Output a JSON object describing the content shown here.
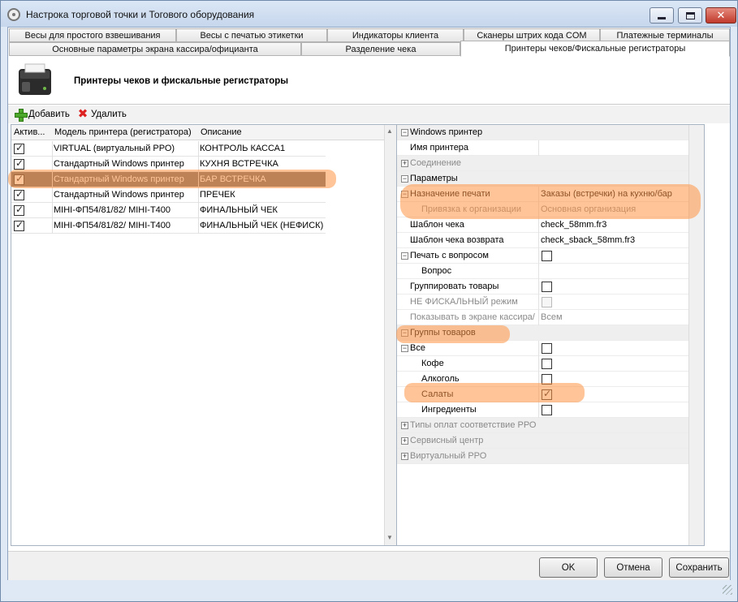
{
  "window": {
    "title": "Настрока торговой точки и Тогового оборудования"
  },
  "tabs_row1": [
    "Весы для простого взвешивания",
    "Весы с печатью этикетки",
    "Индикаторы клиента",
    "Сканеры штрих кода COM",
    "Платежные терминалы"
  ],
  "tabs_row2": [
    "Основные параметры экрана кассира/официанта",
    "Разделение чека",
    "Принтеры чеков/Фискальные регистраторы"
  ],
  "header": {
    "title": "Принтеры чеков и фискальные регистраторы"
  },
  "toolbar": {
    "add_label": "Добавить",
    "delete_label": "Удалить"
  },
  "printers": {
    "columns": [
      "Актив...",
      "Модель принтера (регистратора)",
      "Описание"
    ],
    "rows": [
      {
        "active": true,
        "model": "VIRTUAL (виртуальный РРО)",
        "description": "КОНТРОЛЬ КАССА1"
      },
      {
        "active": true,
        "model": "Стандартный Windows принтер",
        "description": "КУХНЯ ВСТРЕЧКА"
      },
      {
        "active": true,
        "model": "Стандартный Windows принтер",
        "description": "БАР ВСТРЕЧКА",
        "selected": true
      },
      {
        "active": true,
        "model": "Стандартный Windows принтер",
        "description": "ПРЕЧЕК"
      },
      {
        "active": true,
        "model": "МІНІ-ФП54/81/82/  МІНІ-Т400",
        "description": "ФИНАЛЬНЫЙ ЧЕК"
      },
      {
        "active": true,
        "model": "МІНІ-ФП54/81/82/  МІНІ-Т400",
        "description": "ФИНАЛЬНЫЙ ЧЕК (НЕФИСК)"
      }
    ]
  },
  "properties": {
    "rows": [
      {
        "name": "Windows принтер",
        "type": "category",
        "expander": "−"
      },
      {
        "name": "Имя принтера",
        "value": ""
      },
      {
        "name": "Соединение",
        "type": "category",
        "expander": "+",
        "muted": true
      },
      {
        "name": "Параметры",
        "type": "category",
        "expander": "−"
      },
      {
        "name": "Назначение печати",
        "value": "Заказы (встречки) на кухню/бар",
        "expander": "−"
      },
      {
        "name": "Привязка к организации",
        "value": "Основная организация",
        "muted": true,
        "indent": true
      },
      {
        "name": "Шаблон чека",
        "value": "check_58mm.fr3"
      },
      {
        "name": "Шаблон чека возврата",
        "value": "check_sback_58mm.fr3"
      },
      {
        "name": "Печать с вопросом",
        "checkbox": false,
        "expander": "−"
      },
      {
        "name": "Вопрос",
        "value": "",
        "indent": true
      },
      {
        "name": "Группировать товары",
        "checkbox": false
      },
      {
        "name": "НЕ ФИСКАЛЬНЫЙ режим",
        "checkbox": false,
        "muted": true,
        "disabled": true
      },
      {
        "name": "Показывать в экране кассира/",
        "value": "Всем",
        "muted": true
      },
      {
        "name": "Группы товаров",
        "type": "category",
        "expander": "−"
      },
      {
        "name": "Все",
        "checkbox": false,
        "expander": "−"
      },
      {
        "name": "Кофе",
        "checkbox": false,
        "indent": true
      },
      {
        "name": "Алкоголь",
        "checkbox": false,
        "indent": true
      },
      {
        "name": "Салаты",
        "checkbox": true,
        "indent": true
      },
      {
        "name": "Ингредиенты",
        "checkbox": false,
        "indent": true
      },
      {
        "name": "Типы оплат соответствие РРО",
        "type": "category",
        "expander": "+",
        "muted": true
      },
      {
        "name": "Сервисный центр",
        "type": "category",
        "expander": "+",
        "muted": true
      },
      {
        "name": "Виртуальный РРО",
        "type": "category",
        "expander": "+",
        "muted": true
      }
    ]
  },
  "buttons": {
    "ok": "OK",
    "cancel": "Отмена",
    "save": "Сохранить"
  },
  "colors": {
    "highlight": "#ff9646",
    "selected_row": "#6d6d6d",
    "title_bar": "#c6d6ec"
  }
}
